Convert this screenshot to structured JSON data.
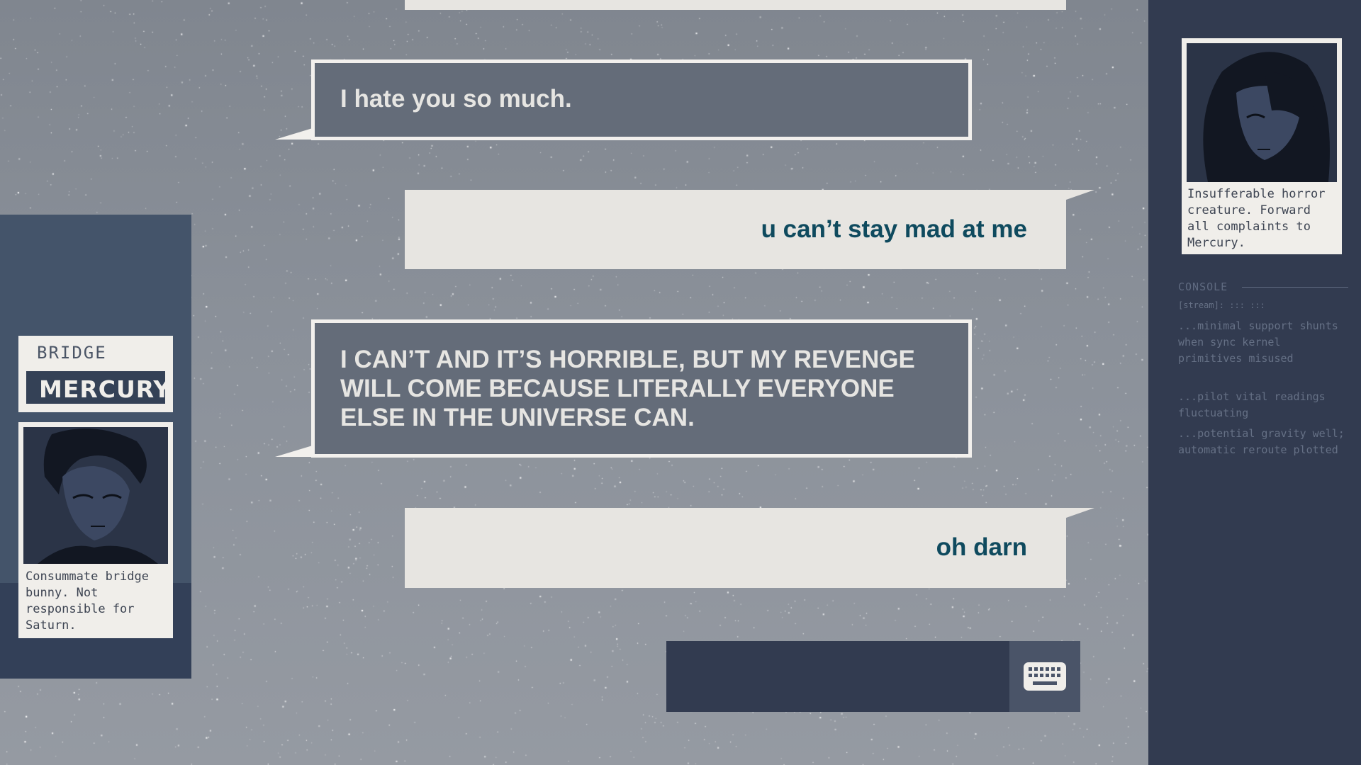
{
  "messages": [
    {
      "side": "them",
      "text": "I hate you so much."
    },
    {
      "side": "me",
      "text": "u can’t stay mad at me"
    },
    {
      "side": "them",
      "text": "I CAN’T AND IT’S HORRIBLE, BUT MY REVENGE WILL COME BECAUSE LITERALLY EVERYONE ELSE IN THE UNIVERSE CAN."
    },
    {
      "side": "me",
      "text": "oh darn"
    }
  ],
  "left_character": {
    "location": "BRIDGE",
    "name": "MERCURY",
    "portrait_icon": "mercury-portrait",
    "description": "Consummate bridge bunny. Not responsible for Saturn."
  },
  "right_character": {
    "portrait_icon": "saturn-portrait",
    "description": "Insufferable horror creature. Forward all complaints to Mercury."
  },
  "console": {
    "heading": "CONSOLE",
    "lines": [
      "[stream]: ::: :::",
      "...minimal support shunts when sync kernel primitives misused",
      "...pilot vital readings fluctuating",
      "...potential gravity well; automatic reroute plotted"
    ]
  },
  "input": {
    "value": "",
    "keyboard_icon": "keyboard-icon"
  },
  "colors": {
    "them_bubble": "#646c79",
    "me_bubble": "#e7e5e1",
    "me_text": "#0f4a5e",
    "panel": "#323b50"
  }
}
